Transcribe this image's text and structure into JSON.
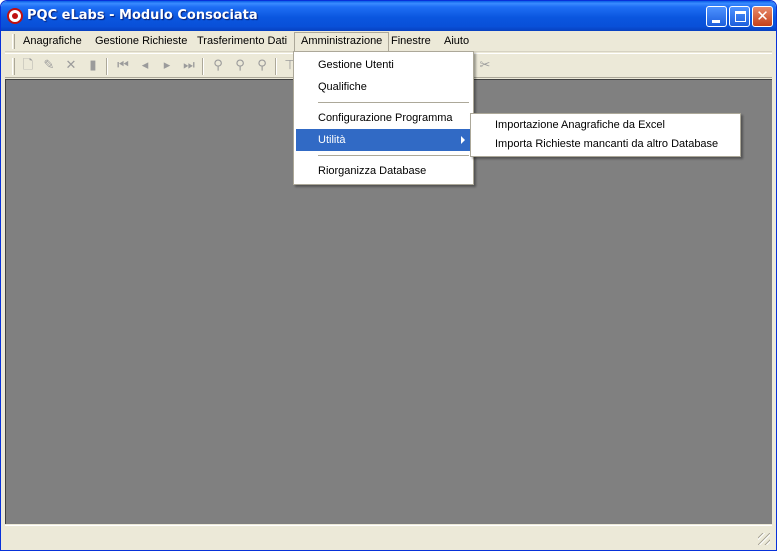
{
  "window": {
    "title": "PQC eLabs - Modulo Consociata",
    "icon": "app-logo-icon",
    "controls": [
      "minimize-icon",
      "maximize-icon",
      "close-icon"
    ]
  },
  "menubar": {
    "items": [
      {
        "label": "Anagrafiche"
      },
      {
        "label": "Gestione Richieste"
      },
      {
        "label": "Trasferimento Dati"
      },
      {
        "label": "Amministrazione",
        "active": true
      },
      {
        "label": "Finestre"
      },
      {
        "label": "Aiuto"
      }
    ]
  },
  "toolbar": {
    "icons": [
      "new-icon",
      "edit-icon",
      "delete-icon",
      "trash-icon",
      "first-record-icon",
      "previous-record-icon",
      "next-record-icon",
      "last-record-icon",
      "find-icon",
      "find-next-icon",
      "find-previous-icon",
      "filter-icon",
      "cut-icon"
    ]
  },
  "admin_menu": {
    "items": [
      {
        "label": "Gestione Utenti"
      },
      {
        "label": "Qualifiche"
      },
      {
        "label": "Configurazione Programma"
      },
      {
        "label": "Utilità",
        "has_submenu": true,
        "selected": true
      },
      {
        "label": "Riorganizza Database"
      }
    ]
  },
  "utility_submenu": {
    "items": [
      {
        "label": "Importazione Anagrafiche da Excel"
      },
      {
        "label": "Importa Richieste mancanti da altro Database"
      }
    ]
  },
  "colors": {
    "titlebar": "#0a56df",
    "menu_highlight": "#316ac5",
    "mdi_background": "#808080",
    "chrome": "#ece9d8"
  }
}
